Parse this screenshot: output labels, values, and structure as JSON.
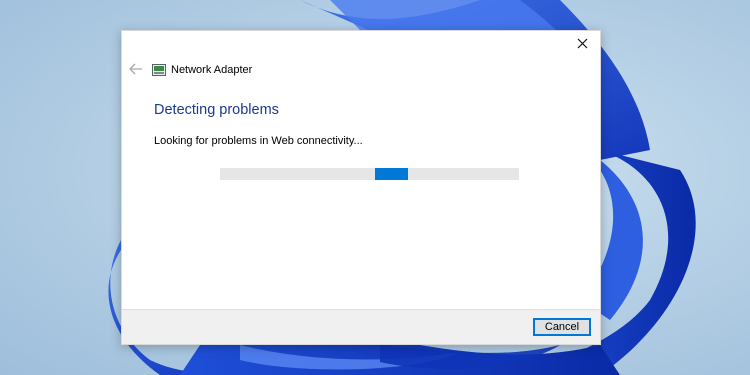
{
  "window": {
    "title": "Network Adapter",
    "close_icon": "close-icon",
    "back_icon": "back-arrow-icon",
    "title_icon": "network-adapter-icon"
  },
  "main": {
    "heading": "Detecting problems",
    "status": "Looking for problems in Web connectivity...",
    "progress": {
      "type": "indeterminate",
      "chunk_position_fraction": 0.52
    }
  },
  "footer": {
    "cancel_label": "Cancel"
  },
  "colors": {
    "accent": "#0078d7",
    "heading": "#1a3a8c",
    "footer_bg": "#f0f0f0",
    "track": "#e6e6e6"
  }
}
